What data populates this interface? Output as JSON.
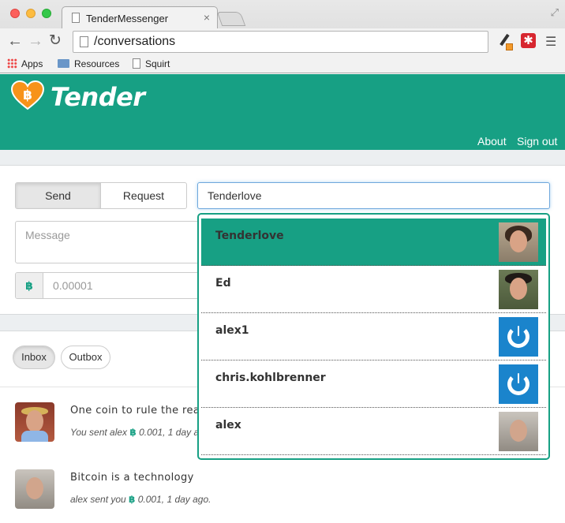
{
  "browser": {
    "tab_title": "TenderMessenger",
    "tab_close": "×",
    "url": "/conversations",
    "bookmarks": [
      {
        "label": "Apps",
        "icon": "apps-grid-icon"
      },
      {
        "label": "Resources",
        "icon": "folder-icon"
      },
      {
        "label": "Squirt",
        "icon": "page-icon"
      }
    ]
  },
  "app": {
    "brand": "Tender",
    "brand_color": "#17a084",
    "nav": {
      "about": "About",
      "signout": "Sign out"
    }
  },
  "compose": {
    "mode_send": "Send",
    "mode_request": "Request",
    "active_mode": "Send",
    "recipient_value": "Tenderlove",
    "message_placeholder": "Message",
    "currency_symbol": "฿",
    "amount_placeholder": "0.00001"
  },
  "typeahead": {
    "active_index": 0,
    "items": [
      {
        "name": "Tenderlove",
        "avatar": "photo"
      },
      {
        "name": "Ed",
        "avatar": "photo"
      },
      {
        "name": "alex1",
        "avatar": "power-icon"
      },
      {
        "name": "chris.kohlbrenner",
        "avatar": "power-icon"
      },
      {
        "name": "alex",
        "avatar": "photo"
      }
    ]
  },
  "mailbox": {
    "inbox_label": "Inbox",
    "outbox_label": "Outbox",
    "active": "Inbox"
  },
  "conversations": [
    {
      "text": "One coin to rule the rea",
      "meta_prefix": "You sent alex ",
      "currency": "฿",
      "meta_suffix": "0.001, 1 day a"
    },
    {
      "text": "Bitcoin is a technology",
      "meta_prefix": "alex sent you ",
      "currency": "฿",
      "meta_suffix": "0.001, 1 day ago."
    }
  ]
}
